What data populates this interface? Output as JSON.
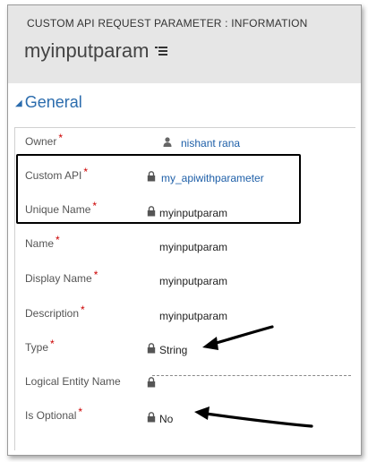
{
  "header": {
    "entity_label": "CUSTOM API REQUEST PARAMETER : INFORMATION",
    "record_title": "myinputparam"
  },
  "section": {
    "title": "General"
  },
  "fields": {
    "owner": {
      "label": "Owner",
      "value": "nishant rana"
    },
    "custom_api": {
      "label": "Custom API",
      "value": "my_apiwithparameter"
    },
    "unique_name": {
      "label": "Unique Name",
      "value": "myinputparam"
    },
    "name": {
      "label": "Name",
      "value": "myinputparam"
    },
    "display_name": {
      "label": "Display Name",
      "value": "myinputparam"
    },
    "description": {
      "label": "Description",
      "value": "myinputparam"
    },
    "type": {
      "label": "Type",
      "value": "String"
    },
    "logical_entity_name": {
      "label": "Logical Entity Name",
      "value": ""
    },
    "is_optional": {
      "label": "Is Optional",
      "value": "No"
    }
  },
  "required_marker": "*",
  "colors": {
    "link": "#1e5fa8",
    "required": "#cc0000",
    "header_bg": "#e6e6e6",
    "section_title": "#2b6cad"
  }
}
